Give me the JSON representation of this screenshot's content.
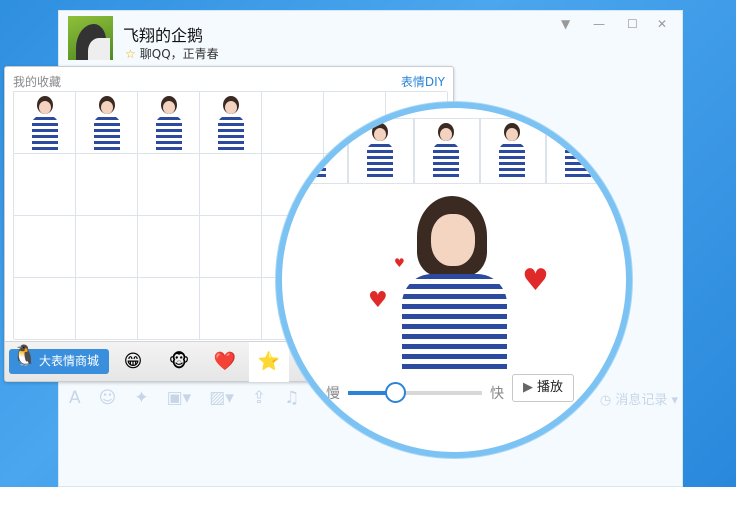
{
  "contact": {
    "name": "飞翔的企鹅",
    "signature": "聊QQ，正青春"
  },
  "window_controls": {
    "menu": "▼",
    "minimize": "—",
    "maximize": "☐",
    "close": "✕"
  },
  "panel": {
    "title": "我的收藏",
    "diy_label": "表情DIY",
    "shop_label": "大表情商城",
    "tabs": [
      {
        "name": "emoji",
        "icon": "😁"
      },
      {
        "name": "monkey",
        "icon": "🐵"
      },
      {
        "name": "heart",
        "icon": "❤️"
      },
      {
        "name": "favorites",
        "icon": "⭐"
      }
    ]
  },
  "preview": {
    "slow_label": "慢",
    "fast_label": "快",
    "play_label": "播放",
    "speed": 0.35
  },
  "toolbar": {
    "icons": [
      "A",
      "☺",
      "✦",
      "▣▾",
      "▨▾",
      "⇪",
      "♫"
    ],
    "history_label": "消息记录"
  },
  "colors": {
    "accent": "#2a83d8",
    "circle_border": "#7cc3f3",
    "background": "#3b9be6"
  }
}
